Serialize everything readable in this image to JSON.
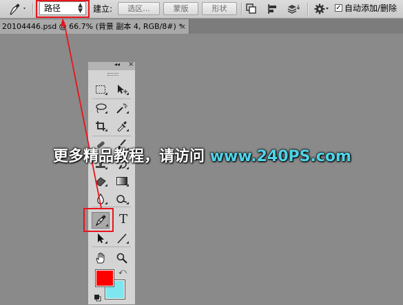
{
  "options_bar": {
    "tool_icon": "pen-icon",
    "mode_value": "路径",
    "build_label": "建立:",
    "selection_button": "选区...",
    "mask_button": "蒙版",
    "shape_button": "形状",
    "path_ops_icon": "path-operations-icon",
    "path_align_icon": "path-alignment-icon",
    "path_arrange_icon": "path-arrangement-icon",
    "settings_icon": "gear-icon",
    "auto_add_checked": true,
    "auto_add_label": "自动添加/删除"
  },
  "document_tab": {
    "title": "20104446.psd @ 66.7% (背景 副本 4, RGB/8#) *",
    "close": "×"
  },
  "toolbox": {
    "collapse_glyph": "◂◂",
    "close_glyph": "×",
    "type_tool_glyph": "T",
    "foreground_color": "#ff0000",
    "background_color": "#7ee6ee"
  },
  "watermark": {
    "text_part1": "更多精品教程，请访问 ",
    "text_part2": "www.240PS.com"
  },
  "annotation": {
    "color": "#e8141b"
  }
}
